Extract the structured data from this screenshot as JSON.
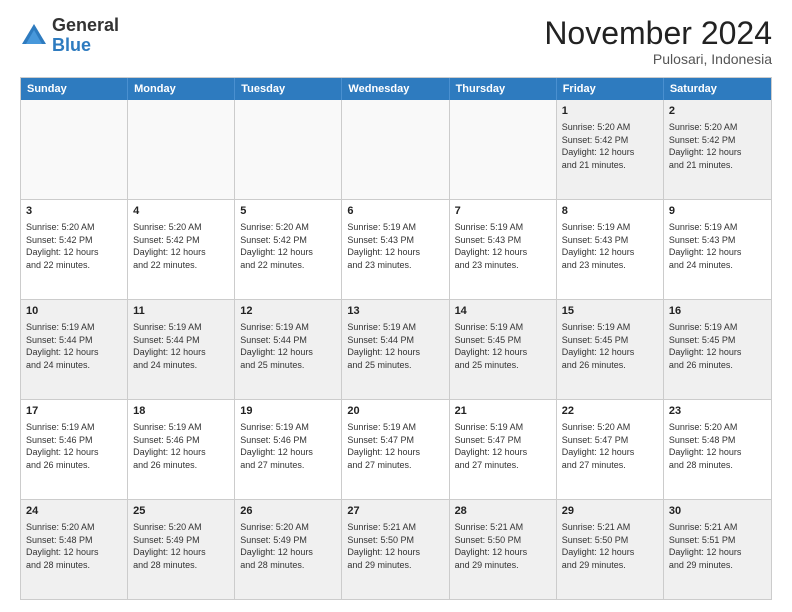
{
  "header": {
    "logo_general": "General",
    "logo_blue": "Blue",
    "month_title": "November 2024",
    "subtitle": "Pulosari, Indonesia"
  },
  "weekdays": [
    "Sunday",
    "Monday",
    "Tuesday",
    "Wednesday",
    "Thursday",
    "Friday",
    "Saturday"
  ],
  "rows": [
    [
      {
        "day": "",
        "empty": true
      },
      {
        "day": "",
        "empty": true
      },
      {
        "day": "",
        "empty": true
      },
      {
        "day": "",
        "empty": true
      },
      {
        "day": "",
        "empty": true
      },
      {
        "day": "1",
        "info": "Sunrise: 5:20 AM\nSunset: 5:42 PM\nDaylight: 12 hours\nand 21 minutes."
      },
      {
        "day": "2",
        "info": "Sunrise: 5:20 AM\nSunset: 5:42 PM\nDaylight: 12 hours\nand 21 minutes."
      }
    ],
    [
      {
        "day": "3",
        "info": "Sunrise: 5:20 AM\nSunset: 5:42 PM\nDaylight: 12 hours\nand 22 minutes."
      },
      {
        "day": "4",
        "info": "Sunrise: 5:20 AM\nSunset: 5:42 PM\nDaylight: 12 hours\nand 22 minutes."
      },
      {
        "day": "5",
        "info": "Sunrise: 5:20 AM\nSunset: 5:42 PM\nDaylight: 12 hours\nand 22 minutes."
      },
      {
        "day": "6",
        "info": "Sunrise: 5:19 AM\nSunset: 5:43 PM\nDaylight: 12 hours\nand 23 minutes."
      },
      {
        "day": "7",
        "info": "Sunrise: 5:19 AM\nSunset: 5:43 PM\nDaylight: 12 hours\nand 23 minutes."
      },
      {
        "day": "8",
        "info": "Sunrise: 5:19 AM\nSunset: 5:43 PM\nDaylight: 12 hours\nand 23 minutes."
      },
      {
        "day": "9",
        "info": "Sunrise: 5:19 AM\nSunset: 5:43 PM\nDaylight: 12 hours\nand 24 minutes."
      }
    ],
    [
      {
        "day": "10",
        "info": "Sunrise: 5:19 AM\nSunset: 5:44 PM\nDaylight: 12 hours\nand 24 minutes."
      },
      {
        "day": "11",
        "info": "Sunrise: 5:19 AM\nSunset: 5:44 PM\nDaylight: 12 hours\nand 24 minutes."
      },
      {
        "day": "12",
        "info": "Sunrise: 5:19 AM\nSunset: 5:44 PM\nDaylight: 12 hours\nand 25 minutes."
      },
      {
        "day": "13",
        "info": "Sunrise: 5:19 AM\nSunset: 5:44 PM\nDaylight: 12 hours\nand 25 minutes."
      },
      {
        "day": "14",
        "info": "Sunrise: 5:19 AM\nSunset: 5:45 PM\nDaylight: 12 hours\nand 25 minutes."
      },
      {
        "day": "15",
        "info": "Sunrise: 5:19 AM\nSunset: 5:45 PM\nDaylight: 12 hours\nand 26 minutes."
      },
      {
        "day": "16",
        "info": "Sunrise: 5:19 AM\nSunset: 5:45 PM\nDaylight: 12 hours\nand 26 minutes."
      }
    ],
    [
      {
        "day": "17",
        "info": "Sunrise: 5:19 AM\nSunset: 5:46 PM\nDaylight: 12 hours\nand 26 minutes."
      },
      {
        "day": "18",
        "info": "Sunrise: 5:19 AM\nSunset: 5:46 PM\nDaylight: 12 hours\nand 26 minutes."
      },
      {
        "day": "19",
        "info": "Sunrise: 5:19 AM\nSunset: 5:46 PM\nDaylight: 12 hours\nand 27 minutes."
      },
      {
        "day": "20",
        "info": "Sunrise: 5:19 AM\nSunset: 5:47 PM\nDaylight: 12 hours\nand 27 minutes."
      },
      {
        "day": "21",
        "info": "Sunrise: 5:19 AM\nSunset: 5:47 PM\nDaylight: 12 hours\nand 27 minutes."
      },
      {
        "day": "22",
        "info": "Sunrise: 5:20 AM\nSunset: 5:47 PM\nDaylight: 12 hours\nand 27 minutes."
      },
      {
        "day": "23",
        "info": "Sunrise: 5:20 AM\nSunset: 5:48 PM\nDaylight: 12 hours\nand 28 minutes."
      }
    ],
    [
      {
        "day": "24",
        "info": "Sunrise: 5:20 AM\nSunset: 5:48 PM\nDaylight: 12 hours\nand 28 minutes."
      },
      {
        "day": "25",
        "info": "Sunrise: 5:20 AM\nSunset: 5:49 PM\nDaylight: 12 hours\nand 28 minutes."
      },
      {
        "day": "26",
        "info": "Sunrise: 5:20 AM\nSunset: 5:49 PM\nDaylight: 12 hours\nand 28 minutes."
      },
      {
        "day": "27",
        "info": "Sunrise: 5:21 AM\nSunset: 5:50 PM\nDaylight: 12 hours\nand 29 minutes."
      },
      {
        "day": "28",
        "info": "Sunrise: 5:21 AM\nSunset: 5:50 PM\nDaylight: 12 hours\nand 29 minutes."
      },
      {
        "day": "29",
        "info": "Sunrise: 5:21 AM\nSunset: 5:50 PM\nDaylight: 12 hours\nand 29 minutes."
      },
      {
        "day": "30",
        "info": "Sunrise: 5:21 AM\nSunset: 5:51 PM\nDaylight: 12 hours\nand 29 minutes."
      }
    ]
  ]
}
